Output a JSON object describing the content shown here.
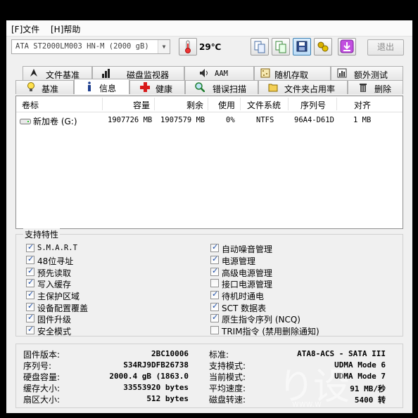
{
  "menu": {
    "file": "[F]文件",
    "help": "[H]帮助"
  },
  "toolbar": {
    "drive_select": "ATA    ST2000LM003 HN-M (2000 gB)",
    "temperature": "29℃",
    "exit_label": "退出",
    "icons": [
      "copy-icon",
      "copy-all-icon",
      "save-icon",
      "options-icon",
      "download-icon"
    ]
  },
  "tabs_row1": [
    "文件基准",
    "磁盘监视器",
    "AAM",
    "随机存取",
    "额外测试"
  ],
  "tabs_row2": [
    "基准",
    "信息",
    "健康",
    "错误扫描",
    "文件夹占用率",
    "删除"
  ],
  "selected_tab": "信息",
  "volume_list": {
    "columns": [
      "卷标",
      "容量",
      "剩余",
      "使用",
      "文件系统",
      "序列号",
      "对齐"
    ],
    "rows": [
      {
        "label": "新加卷 (G:)",
        "capacity": "1907726 MB",
        "free": "1907579 MB",
        "used": "0%",
        "fs": "NTFS",
        "serial": "96A4-D61D",
        "align": "1 MB"
      }
    ]
  },
  "features": {
    "title": "支持特性",
    "left": [
      {
        "label": "S.M.A.R.T",
        "checked": true
      },
      {
        "label": "48位寻址",
        "checked": true
      },
      {
        "label": "预先读取",
        "checked": true
      },
      {
        "label": "写入缓存",
        "checked": true
      },
      {
        "label": "主保护区域",
        "checked": true
      },
      {
        "label": "设备配置覆盖",
        "checked": true
      },
      {
        "label": "固件升级",
        "checked": true
      },
      {
        "label": "安全模式",
        "checked": true
      }
    ],
    "right": [
      {
        "label": "自动噪音管理",
        "checked": true
      },
      {
        "label": "电源管理",
        "checked": true
      },
      {
        "label": "高级电源管理",
        "checked": true
      },
      {
        "label": "接口电源管理",
        "checked": false
      },
      {
        "label": "待机时通电",
        "checked": true
      },
      {
        "label": "SCT 数据表",
        "checked": true
      },
      {
        "label": "原生指令序列 (NCQ)",
        "checked": true
      },
      {
        "label": "TRIM指令 (禁用删除通知)",
        "checked": false
      }
    ]
  },
  "info": {
    "left": [
      {
        "label": "固件版本:",
        "value": "2BC10006"
      },
      {
        "label": "序列号:",
        "value": "S34RJ9DFB26738"
      },
      {
        "label": "硬盘容量:",
        "value": "2000.4 gB (1863.0"
      },
      {
        "label": "缓存大小:",
        "value": "33553920 bytes"
      },
      {
        "label": "扇区大小:",
        "value": "512 bytes"
      }
    ],
    "right": [
      {
        "label": "标准:",
        "value": "ATA8-ACS - SATA III"
      },
      {
        "label": "支持模式:",
        "value": "UDMA Mode 6"
      },
      {
        "label": "当前模式:",
        "value": "UDMA Mode 7"
      },
      {
        "label": "平均速度:",
        "value": "91 MB/秒"
      },
      {
        "label": "磁盘转速:",
        "value": "5400 转"
      }
    ]
  },
  "watermark": {
    "text": "り设",
    "url": "www.w"
  }
}
